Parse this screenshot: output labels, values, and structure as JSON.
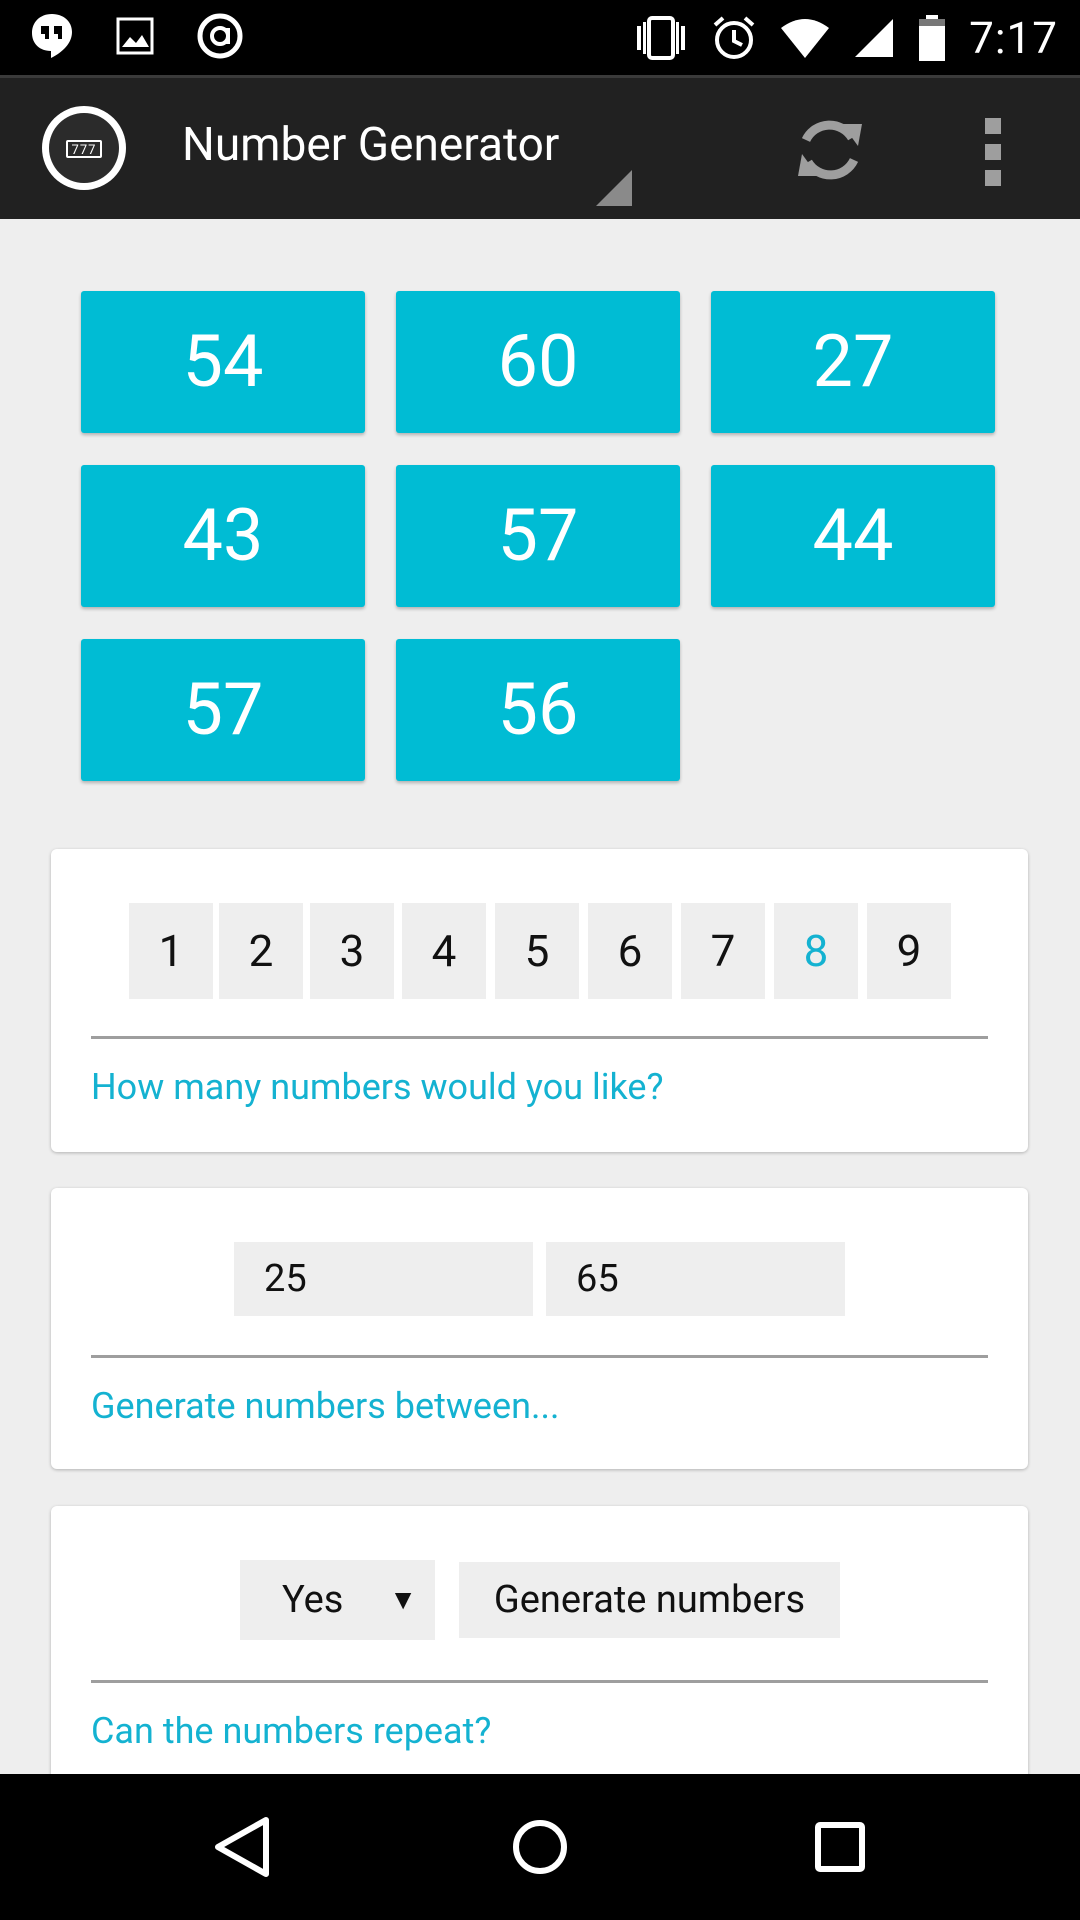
{
  "status_bar": {
    "time": "7:17",
    "left_icons": [
      "hangouts-icon",
      "image-icon",
      "circle-a-icon"
    ],
    "right_icons": [
      "vibrate-icon",
      "alarm-icon",
      "wifi-icon",
      "signal-icon",
      "battery-icon"
    ]
  },
  "action_bar": {
    "title": "Number Generator",
    "app_icon_text": "777",
    "actions": [
      "refresh-icon",
      "overflow-menu-icon"
    ]
  },
  "results": [
    "54",
    "60",
    "27",
    "43",
    "57",
    "44",
    "57",
    "56"
  ],
  "count_card": {
    "options": [
      "1",
      "2",
      "3",
      "4",
      "5",
      "6",
      "7",
      "8",
      "9"
    ],
    "selected": "8",
    "caption": "How many numbers would you like?"
  },
  "range_card": {
    "min": "25",
    "max": "65",
    "caption": "Generate numbers between..."
  },
  "repeat_card": {
    "selected": "Yes",
    "dropdown_arrow": "▼",
    "button_label": "Generate numbers",
    "caption": "Can the numbers repeat?"
  },
  "nav_bar": [
    "back-icon",
    "home-icon",
    "recents-icon"
  ],
  "colors": {
    "accent": "#00bcd4",
    "caption_text": "#14b2d1",
    "action_bar": "#212121",
    "background": "#eeeeee"
  }
}
